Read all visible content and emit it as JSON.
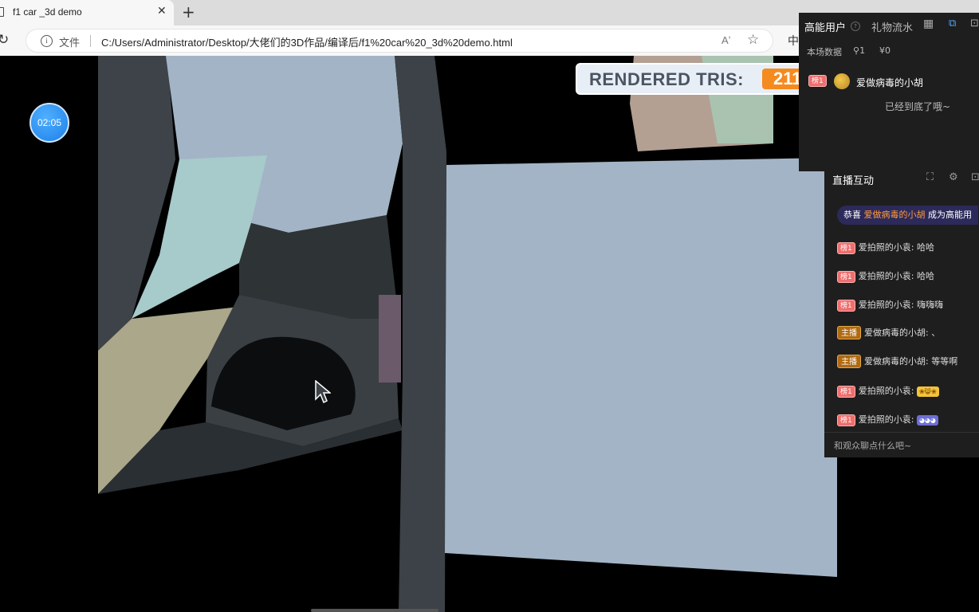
{
  "browser": {
    "tab_title": "f1 car _3d demo",
    "tab_close": "✕",
    "new_tab": "+",
    "refresh": "↻",
    "file_label": "文件",
    "url": "C:/Users/Administrator/Desktop/大佬们的3D作品/编译后/f1%20car%20_3d%20demo.html",
    "read_aloud": "Aʼ",
    "favorite": "☆",
    "ime": "中"
  },
  "demo": {
    "timer": "02:05",
    "tris_label": "RENDERED TRIS:",
    "tris_value": "211"
  },
  "live_panel": {
    "tab_high_energy": "高能用户",
    "tab_gift_flow": "礼物流水",
    "help": "?",
    "stats_label": "本场数据",
    "viewers": "1",
    "money": "0",
    "top_user": {
      "badge": "榜1",
      "name": "爱做病毒的小胡"
    },
    "end_text": "已经到底了哦~"
  },
  "interaction": {
    "title": "直播互动",
    "congrats_prefix": "恭喜",
    "congrats_name": "爱做病毒的小胡",
    "congrats_suffix": "成为高能用",
    "messages": [
      {
        "badge": "榜1",
        "user": "爱拍照的小袁:",
        "text": "哈哈"
      },
      {
        "badge": "榜1",
        "user": "爱拍照的小袁:",
        "text": "哈哈"
      },
      {
        "badge": "榜1",
        "user": "爱拍照的小袁:",
        "text": "嗨嗨嗨"
      },
      {
        "badge": "主播",
        "user": "爱做病毒的小胡:",
        "text": "、"
      },
      {
        "badge": "主播",
        "user": "爱做病毒的小胡:",
        "text": "等等啊"
      },
      {
        "badge": "榜1",
        "user": "爱拍照的小袁:",
        "text": ""
      },
      {
        "badge": "榜1",
        "user": "爱拍照的小袁:",
        "text": ""
      }
    ],
    "input_placeholder": "和观众聊点什么吧~"
  },
  "colors": {
    "tris_badge": "#f58a1f",
    "level_badge": "#f06e6e",
    "host_badge": "#b06a12",
    "panel_bg": "#1e1e1e",
    "congrats_name": "#ff9a3d"
  }
}
